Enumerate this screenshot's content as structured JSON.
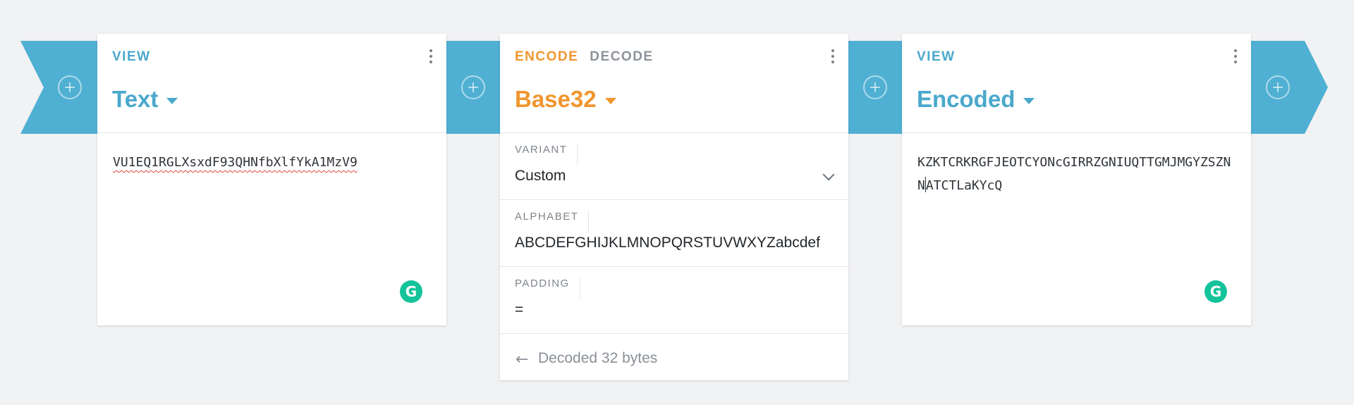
{
  "colors": {
    "band": "#4fb0d3",
    "blue": "#4aa8cc",
    "orange": "#f0962e",
    "grammarly": "#15c39a"
  },
  "pipeline": {
    "add_buttons": [
      "add-icon",
      "add-icon",
      "add-icon",
      "add-icon"
    ]
  },
  "left_card": {
    "tab": "VIEW",
    "title": "Text",
    "content": "VU1EQ1RGLXsxdF93QHNfbXlfYkA1MzV9",
    "menu_icon": "kebab-icon",
    "assistant_icon": "grammarly-icon",
    "assistant_glyph": "G"
  },
  "middle_card": {
    "tab_encode": "ENCODE",
    "tab_decode": "DECODE",
    "title": "Base32",
    "fields": {
      "variant_label": "VARIANT",
      "variant_value": "Custom",
      "alphabet_label": "ALPHABET",
      "alphabet_value": "ABCDEFGHIJKLMNOPQRSTUVWXYZabcdef",
      "padding_label": "PADDING",
      "padding_value": "="
    },
    "footer_arrow": "←",
    "footer_text": "Decoded 32 bytes"
  },
  "right_card": {
    "tab": "VIEW",
    "title": "Encoded",
    "content_before_caret": "KZKTCRKRGFJEOTCYONcGIRRZGNIUQTTGMJMGYZSZNN",
    "content_after_caret": "ATCTLaKYcQ",
    "assistant_glyph": "G"
  }
}
